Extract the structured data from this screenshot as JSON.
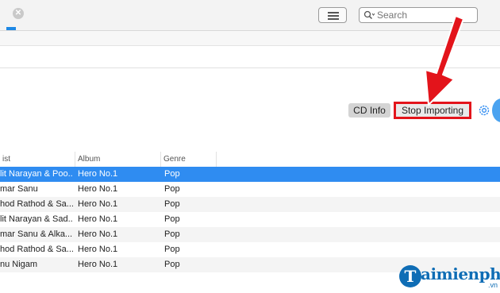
{
  "toolbar": {
    "close_glyph": "✕",
    "search_placeholder": "Search"
  },
  "actions": {
    "cd_info_label": "CD Info",
    "stop_importing_label": "Stop Importing"
  },
  "table": {
    "columns": [
      "ist",
      "Album",
      "Genre"
    ],
    "rows": [
      [
        "lit Narayan & Poo...",
        "Hero No.1",
        "Pop"
      ],
      [
        "mar Sanu",
        "Hero No.1",
        "Pop"
      ],
      [
        "hod Rathod & Sa...",
        "Hero No.1",
        "Pop"
      ],
      [
        "lit Narayan & Sad...",
        "Hero No.1",
        "Pop"
      ],
      [
        "mar Sanu & Alka...",
        "Hero No.1",
        "Pop"
      ],
      [
        "hod Rathod & Sa...",
        "Hero No.1",
        "Pop"
      ],
      [
        "nu Nigam",
        "Hero No.1",
        "Pop"
      ]
    ],
    "selected_row": 0
  },
  "watermark": {
    "logo_letter": "T",
    "name": "aimienphi",
    "suffix": ".vn"
  },
  "colors": {
    "selection": "#2f8cf1",
    "highlight_box": "#e3141b",
    "arrow": "#e3141b",
    "brand": "#0f6db5"
  }
}
